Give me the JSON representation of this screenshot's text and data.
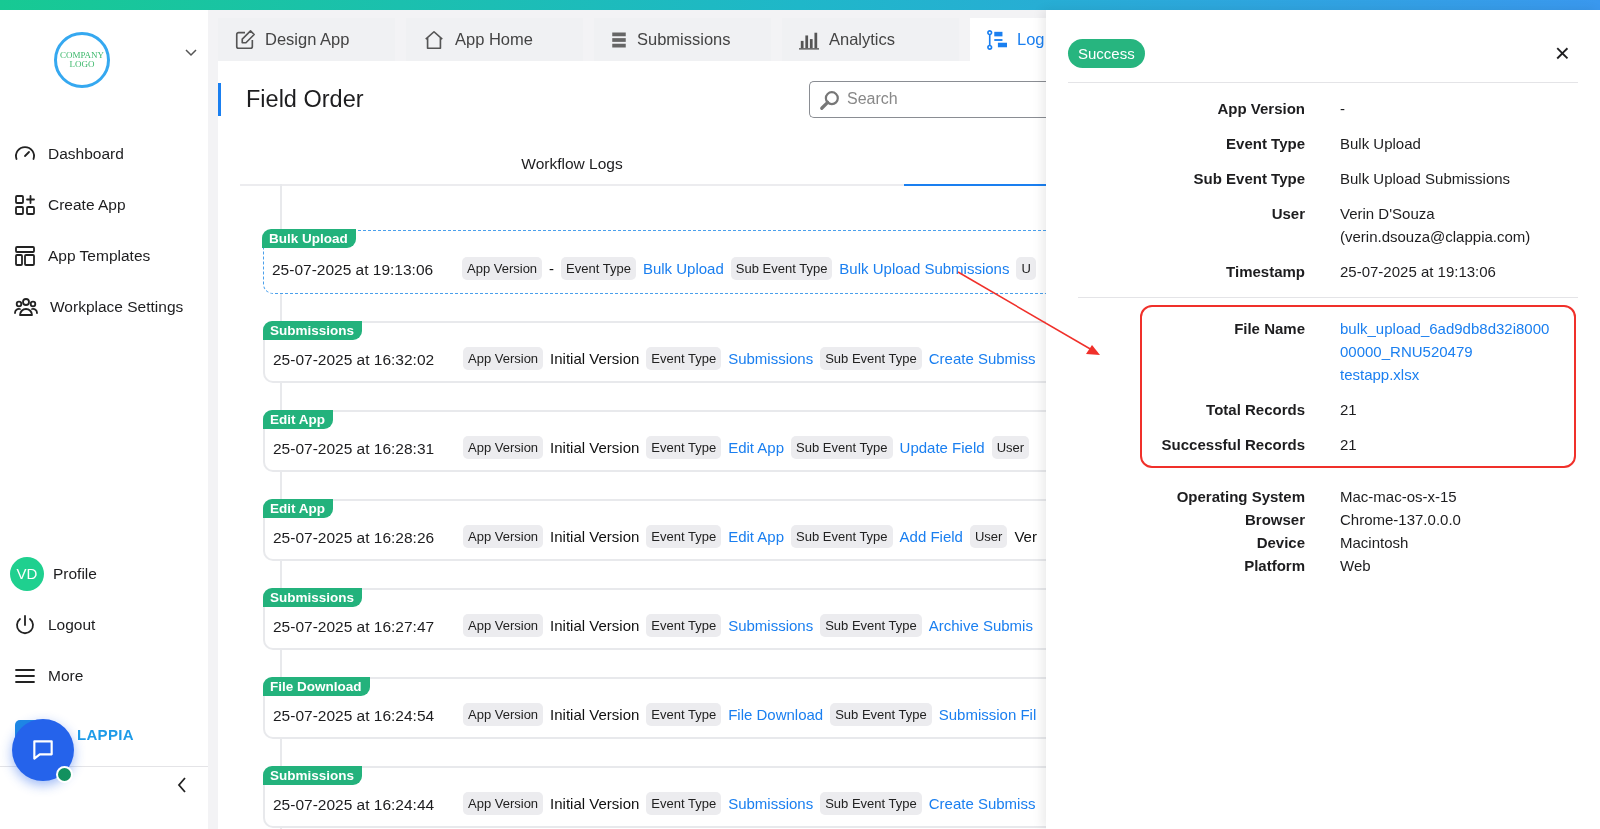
{
  "sidebar": {
    "logo_text": "COMPANY LOGO",
    "nav": [
      {
        "label": "Dashboard"
      },
      {
        "label": "Create App"
      },
      {
        "label": "App Templates"
      },
      {
        "label": "Workplace Settings"
      }
    ],
    "profile": {
      "initials": "VD",
      "label": "Profile"
    },
    "bottom": [
      {
        "label": "Logout"
      },
      {
        "label": "More"
      }
    ],
    "brand": "LAPPIA"
  },
  "tabs": [
    {
      "label": "Design App",
      "selected": false
    },
    {
      "label": "App Home",
      "selected": false
    },
    {
      "label": "Submissions",
      "selected": false
    },
    {
      "label": "Analytics",
      "selected": false
    },
    {
      "label": "Log",
      "selected": true
    }
  ],
  "page": {
    "title": "Field Order",
    "search": {
      "placeholder": "Search"
    },
    "subtabs": [
      {
        "label": "Workflow Logs",
        "selected": false
      },
      {
        "selected": true
      }
    ]
  },
  "log_rows": [
    {
      "badge": "Bulk Upload",
      "timestamp": "25-07-2025 at 19:13:06",
      "selected": true,
      "fields": [
        {
          "kind": "chip",
          "text": "App Version"
        },
        {
          "kind": "value",
          "text": "-"
        },
        {
          "kind": "chip",
          "text": "Event Type"
        },
        {
          "kind": "link",
          "text": "Bulk Upload"
        },
        {
          "kind": "chip",
          "text": "Sub Event Type"
        },
        {
          "kind": "link",
          "text": "Bulk Upload Submissions"
        },
        {
          "kind": "chip",
          "text": "U"
        }
      ]
    },
    {
      "badge": "Submissions",
      "timestamp": "25-07-2025 at 16:32:02",
      "selected": false,
      "fields": [
        {
          "kind": "chip",
          "text": "App Version"
        },
        {
          "kind": "value",
          "text": "Initial Version"
        },
        {
          "kind": "chip",
          "text": "Event Type"
        },
        {
          "kind": "link",
          "text": "Submissions"
        },
        {
          "kind": "chip",
          "text": "Sub Event Type"
        },
        {
          "kind": "link",
          "text": "Create Submiss"
        }
      ]
    },
    {
      "badge": "Edit App",
      "timestamp": "25-07-2025 at 16:28:31",
      "selected": false,
      "fields": [
        {
          "kind": "chip",
          "text": "App Version"
        },
        {
          "kind": "value",
          "text": "Initial Version"
        },
        {
          "kind": "chip",
          "text": "Event Type"
        },
        {
          "kind": "link",
          "text": "Edit App"
        },
        {
          "kind": "chip",
          "text": "Sub Event Type"
        },
        {
          "kind": "link",
          "text": "Update Field"
        },
        {
          "kind": "chip",
          "text": "User"
        }
      ]
    },
    {
      "badge": "Edit App",
      "timestamp": "25-07-2025 at 16:28:26",
      "selected": false,
      "fields": [
        {
          "kind": "chip",
          "text": "App Version"
        },
        {
          "kind": "value",
          "text": "Initial Version"
        },
        {
          "kind": "chip",
          "text": "Event Type"
        },
        {
          "kind": "link",
          "text": "Edit App"
        },
        {
          "kind": "chip",
          "text": "Sub Event Type"
        },
        {
          "kind": "link",
          "text": "Add Field"
        },
        {
          "kind": "chip",
          "text": "User"
        },
        {
          "kind": "value",
          "text": "Ver"
        }
      ]
    },
    {
      "badge": "Submissions",
      "timestamp": "25-07-2025 at 16:27:47",
      "selected": false,
      "fields": [
        {
          "kind": "chip",
          "text": "App Version"
        },
        {
          "kind": "value",
          "text": "Initial Version"
        },
        {
          "kind": "chip",
          "text": "Event Type"
        },
        {
          "kind": "link",
          "text": "Submissions"
        },
        {
          "kind": "chip",
          "text": "Sub Event Type"
        },
        {
          "kind": "link",
          "text": "Archive Submis"
        }
      ]
    },
    {
      "badge": "File Download",
      "timestamp": "25-07-2025 at 16:24:54",
      "selected": false,
      "fields": [
        {
          "kind": "chip",
          "text": "App Version"
        },
        {
          "kind": "value",
          "text": "Initial Version"
        },
        {
          "kind": "chip",
          "text": "Event Type"
        },
        {
          "kind": "link",
          "text": "File Download"
        },
        {
          "kind": "chip",
          "text": "Sub Event Type"
        },
        {
          "kind": "link",
          "text": "Submission Fil"
        }
      ]
    },
    {
      "badge": "Submissions",
      "timestamp": "25-07-2025 at 16:24:44",
      "selected": false,
      "fields": [
        {
          "kind": "chip",
          "text": "App Version"
        },
        {
          "kind": "value",
          "text": "Initial Version"
        },
        {
          "kind": "chip",
          "text": "Event Type"
        },
        {
          "kind": "link",
          "text": "Submissions"
        },
        {
          "kind": "chip",
          "text": "Sub Event Type"
        },
        {
          "kind": "link",
          "text": "Create Submiss"
        }
      ]
    }
  ],
  "detail_panel": {
    "status": "Success",
    "close": "×",
    "sections": [
      {
        "highlighted": false,
        "dense": false,
        "rows": [
          {
            "label": "App Version",
            "kind": "text",
            "lines": [
              "-"
            ]
          },
          {
            "label": "Event Type",
            "kind": "text",
            "lines": [
              "Bulk Upload"
            ]
          },
          {
            "label": "Sub Event Type",
            "kind": "text",
            "lines": [
              "Bulk Upload Submissions"
            ]
          },
          {
            "label": "User",
            "kind": "text",
            "lines": [
              "Verin D'Souza",
              "(verin.dsouza@clappia.com)"
            ]
          },
          {
            "label": "Timestamp",
            "kind": "text",
            "lines": [
              "25-07-2025 at 19:13:06"
            ]
          }
        ]
      },
      {
        "highlighted": true,
        "dense": false,
        "rows": [
          {
            "label": "File Name",
            "kind": "link",
            "lines": [
              "bulk_upload_6ad9db8d32i8000",
              "00000_RNU520479",
              "testapp.xlsx"
            ]
          },
          {
            "label": "Total Records",
            "kind": "text",
            "lines": [
              "21"
            ]
          },
          {
            "label": "Successful Records",
            "kind": "text",
            "lines": [
              "21"
            ]
          }
        ]
      },
      {
        "highlighted": false,
        "dense": true,
        "rows": [
          {
            "label": "Operating System",
            "kind": "text",
            "lines": [
              "Mac-mac-os-x-15"
            ]
          },
          {
            "label": "Browser",
            "kind": "text",
            "lines": [
              "Chrome-137.0.0.0"
            ]
          },
          {
            "label": "Device",
            "kind": "text",
            "lines": [
              "Macintosh"
            ]
          },
          {
            "label": "Platform",
            "kind": "text",
            "lines": [
              "Web"
            ]
          }
        ]
      }
    ]
  }
}
